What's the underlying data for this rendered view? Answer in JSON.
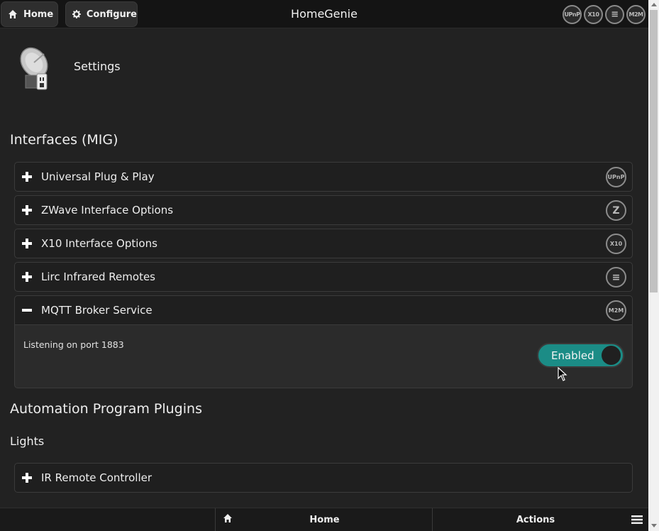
{
  "header": {
    "home_label": "Home",
    "configure_label": "Configure",
    "title": "HomeGenie",
    "status_icons": [
      {
        "name": "upnp-icon",
        "text": "UPnP"
      },
      {
        "name": "x10-icon",
        "text": "X10"
      },
      {
        "name": "lirc-icon",
        "text": "≡"
      },
      {
        "name": "m2m-icon",
        "text": "M2M"
      }
    ]
  },
  "page": {
    "title": "Settings",
    "section_interfaces": "Interfaces (MIG)",
    "section_plugins": "Automation Program Plugins",
    "subsection_lights": "Lights"
  },
  "interfaces": [
    {
      "label": "Universal Plug & Play",
      "icon": "upnp-icon",
      "icon_text": "UPnP",
      "expanded": false
    },
    {
      "label": "ZWave Interface Options",
      "icon": "zwave-icon",
      "icon_text": "Z",
      "expanded": false
    },
    {
      "label": "X10 Interface Options",
      "icon": "x10-icon",
      "icon_text": "X10",
      "expanded": false
    },
    {
      "label": "Lirc Infrared Remotes",
      "icon": "lirc-icon",
      "icon_text": "≡",
      "expanded": false
    },
    {
      "label": "MQTT Broker Service",
      "icon": "m2m-icon",
      "icon_text": "M2M",
      "expanded": true
    }
  ],
  "mqtt_panel": {
    "status_text": "Listening on port 1883",
    "toggle_label": "Enabled",
    "toggle_on": true
  },
  "plugins": [
    {
      "label": "IR Remote Controller",
      "expanded": false
    }
  ],
  "bottom_bar": {
    "home_label": "Home",
    "actions_label": "Actions"
  },
  "colors": {
    "background": "#222222",
    "accent_toggle": "#1b8c86",
    "header": "#141414"
  }
}
